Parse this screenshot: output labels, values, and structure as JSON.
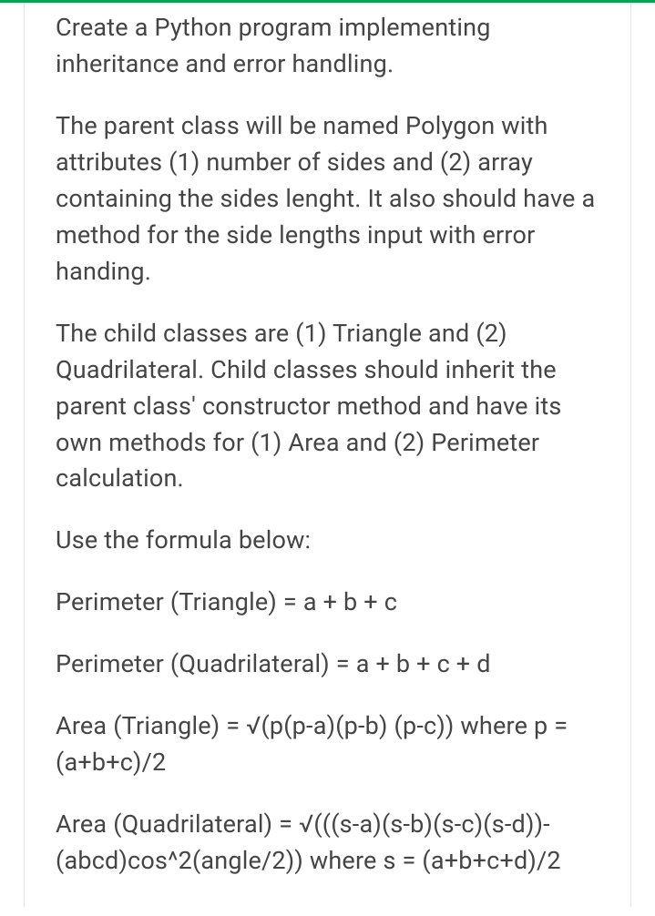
{
  "paragraphs": {
    "p1": "Create a Python program implementing inheritance and error handling.",
    "p2": "The parent class will be named Polygon with attributes (1) number of sides and (2) array containing the sides lenght. It also should have a method for the side lengths input with error handing.",
    "p3": "The child classes are (1) Triangle and (2) Quadrilateral. Child classes should inherit the parent class' constructor method and have its own methods for (1) Area and (2) Perimeter calculation.",
    "p4": "Use the formula below:",
    "p5": "Perimeter (Triangle) = a + b + c",
    "p6": "Perimeter (Quadrilateral) = a + b + c + d",
    "p7": "Area (Triangle) = √(p(p-a)(p-b) (p-c)) where p = (a+b+c)/2",
    "p8": "Area (Quadrilateral) = √(((s-a)(s-b)(s-c)(s-d))-(abcd)cos^2(angle/2)) where s = (a+b+c+d)/2"
  }
}
